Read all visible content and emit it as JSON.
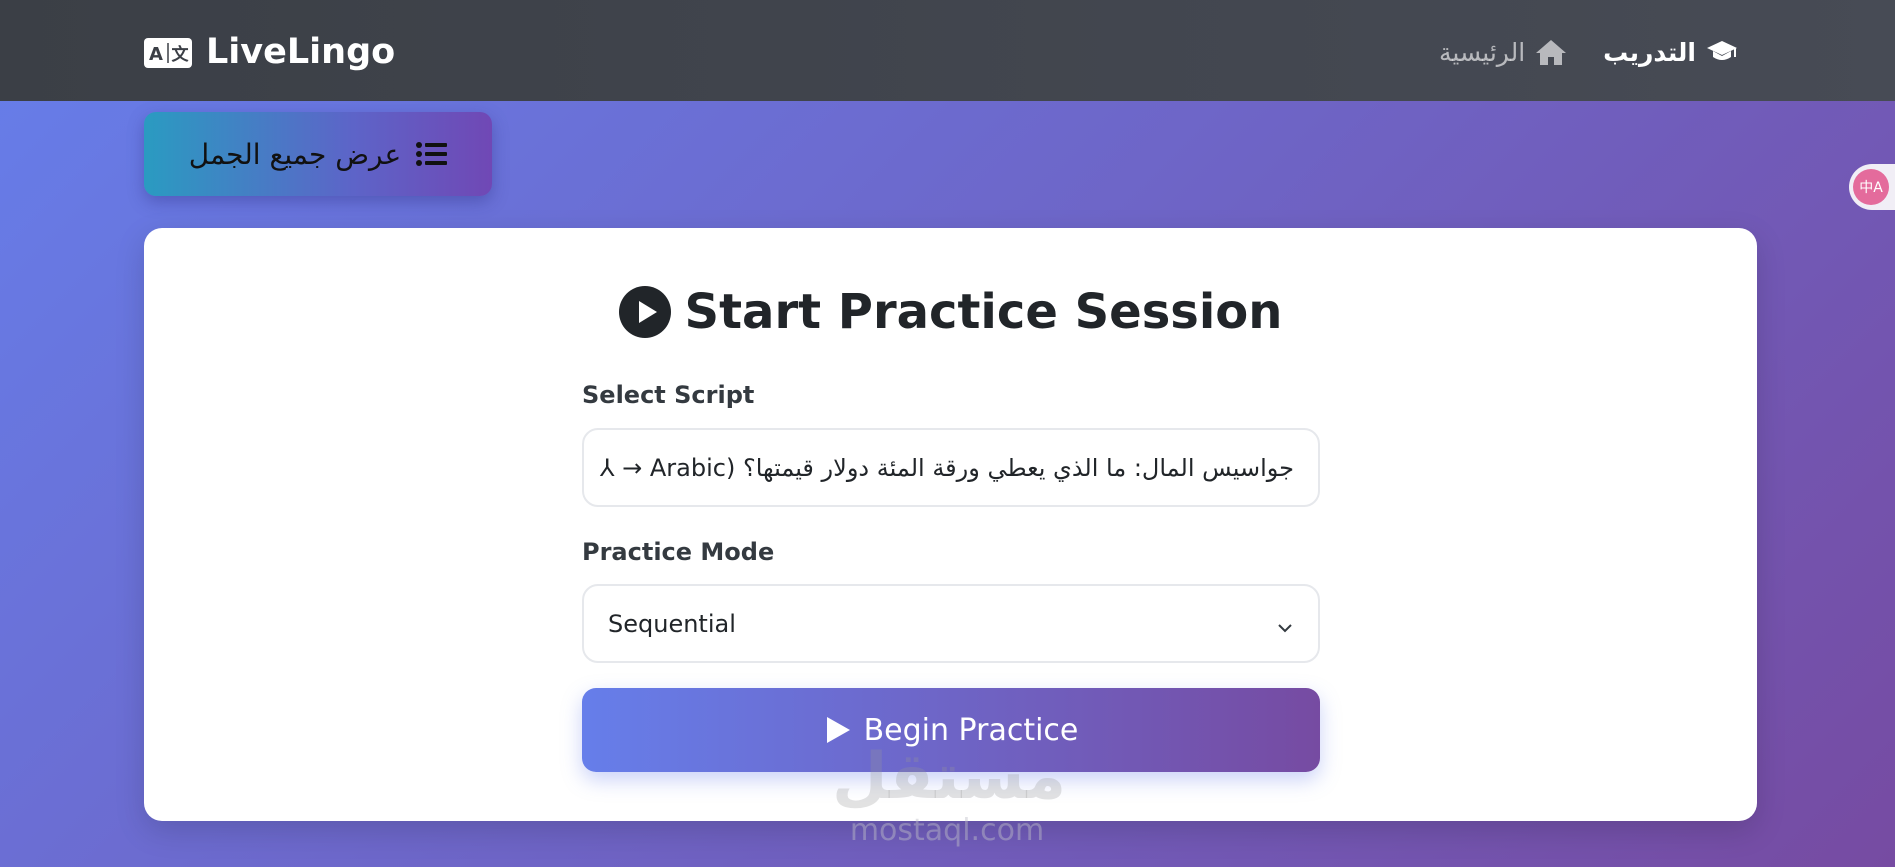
{
  "app": {
    "brand": "LiveLingo",
    "brand_icon": "translate-card-icon"
  },
  "nav": {
    "items": [
      {
        "label": "التدريب",
        "icon": "graduation-cap-icon",
        "active": true
      },
      {
        "label": "الرئيسية",
        "icon": "home-icon",
        "active": false
      }
    ]
  },
  "toolbar": {
    "show_all_label": "عرض جميع الجمل",
    "show_all_icon": "list-icon"
  },
  "translate_tab": {
    "icon": "translate-icon",
    "glyph": "中A"
  },
  "practice": {
    "title": "Start Practice Session",
    "title_icon": "play-circle-icon",
    "script_label": "Select Script",
    "script_value": "جواسيس المال: ما الذي يعطي ورقة المئة دولار قيمتها؟ (Arabic → ⅄",
    "mode_label": "Practice Mode",
    "mode_value": "Sequential",
    "begin_label": "Begin Practice"
  },
  "watermark": {
    "arabic": "مستقل",
    "latin": "mostaql.com"
  },
  "colors": {
    "navbar": "#3b3f46",
    "gradient_start": "#667eea",
    "gradient_end": "#764ba2",
    "card": "#ffffff"
  }
}
